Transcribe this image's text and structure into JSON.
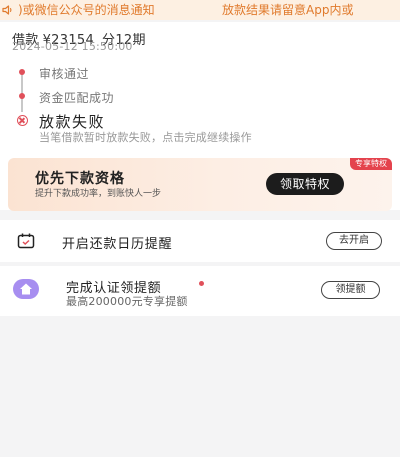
{
  "notice": {
    "text_left": ")或微信公众号的消息通知",
    "text_right": "放款结果请留意App内或"
  },
  "loan": {
    "label": "借款",
    "amount": "¥23154",
    "periods": "分12期",
    "date": "2024-05-12 15:50:00"
  },
  "timeline": {
    "steps": [
      "审核通过",
      "资金匹配成功"
    ],
    "current": {
      "title": "放款失败",
      "desc": "当笔借款暂时放款失败，点击完成继续操作"
    }
  },
  "promo": {
    "tag": "专享特权",
    "title": "优先下款资格",
    "subtitle": "提升下款成功率，到账快人一步",
    "button": "领取特权"
  },
  "calendar_reminder": {
    "label": "开启还款日历提醒",
    "button": "去开启"
  },
  "certification": {
    "label": "完成认证领提额",
    "subtitle": "最高200000元专享提额",
    "button": "领提额"
  },
  "colors": {
    "accent_red": "#e0505a",
    "notice_orange": "#e07a2c",
    "purple_icon": "#a78ef0"
  },
  "icons": [
    "speaker-icon",
    "fail-x-icon",
    "calendar-icon",
    "home-icon"
  ]
}
